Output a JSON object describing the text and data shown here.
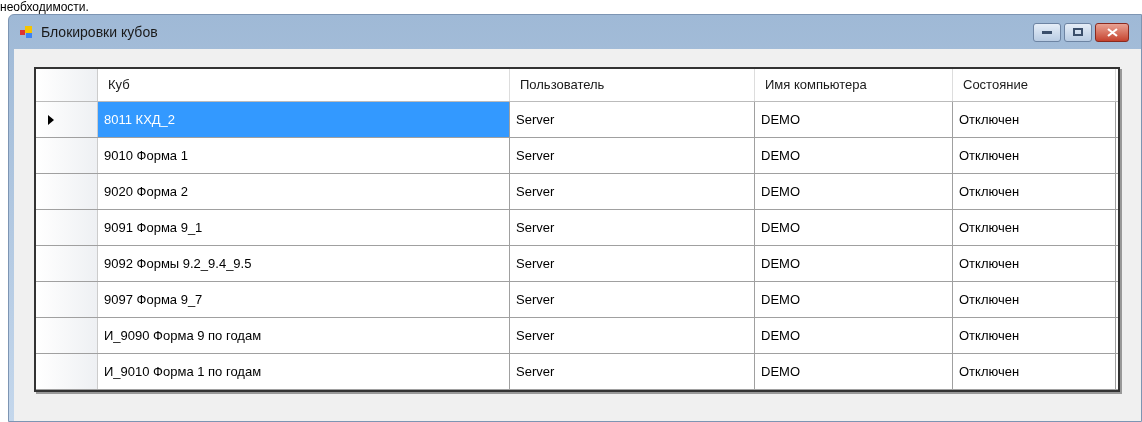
{
  "above_text": "необходимости.",
  "window": {
    "title": "Блокировки кубов"
  },
  "table": {
    "columns": [
      "Куб",
      "Пользователь",
      "Имя компьютера",
      "Состояние"
    ],
    "rows": [
      {
        "selected": true,
        "cells": [
          "8011 КХД_2",
          "Server",
          "DEMO",
          "Отключен"
        ]
      },
      {
        "selected": false,
        "cells": [
          "9010 Форма 1",
          "Server",
          "DEMO",
          "Отключен"
        ]
      },
      {
        "selected": false,
        "cells": [
          "9020 Форма 2",
          "Server",
          "DEMO",
          "Отключен"
        ]
      },
      {
        "selected": false,
        "cells": [
          "9091 Форма 9_1",
          "Server",
          "DEMO",
          "Отключен"
        ]
      },
      {
        "selected": false,
        "cells": [
          "9092 Формы 9.2_9.4_9.5",
          "Server",
          "DEMO",
          "Отключен"
        ]
      },
      {
        "selected": false,
        "cells": [
          "9097 Форма 9_7",
          "Server",
          "DEMO",
          "Отключен"
        ]
      },
      {
        "selected": false,
        "cells": [
          "И_9090 Форма 9 по годам",
          "Server",
          "DEMO",
          "Отключен"
        ]
      },
      {
        "selected": false,
        "cells": [
          "И_9010 Форма 1 по годам",
          "Server",
          "DEMO",
          "Отключен"
        ]
      }
    ]
  }
}
